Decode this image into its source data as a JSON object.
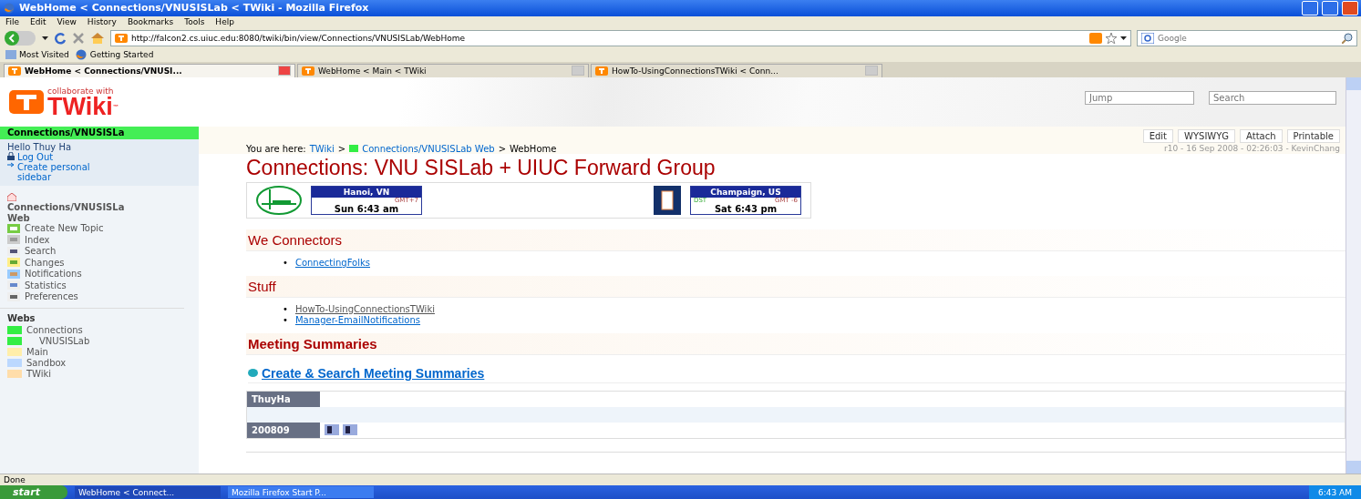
{
  "window": {
    "title": "WebHome < Connections/VNUSISLab < TWiki - Mozilla Firefox"
  },
  "menu": [
    "File",
    "Edit",
    "View",
    "History",
    "Bookmarks",
    "Tools",
    "Help"
  ],
  "nav": {
    "url": "http://falcon2.cs.uiuc.edu:8080/twiki/bin/view/Connections/VNUSISLab/WebHome",
    "search_placeholder": "Google"
  },
  "bookmarks": [
    "Most Visited",
    "Getting Started"
  ],
  "tabs": [
    {
      "label": "WebHome < Connections/VNUSI...",
      "selected": true
    },
    {
      "label": "WebHome < Main < TWiki",
      "selected": false
    },
    {
      "label": "HowTo-UsingConnectionsTWiki < Conn...",
      "selected": false
    }
  ],
  "header": {
    "tagline": "collaborate with",
    "logo": "TWiki",
    "tm": "™",
    "jump_placeholder": "Jump",
    "search_placeholder": "Search"
  },
  "sidebar": {
    "web_bar": "Connections/VNUSISLa",
    "greeting": "Hello Thuy Ha",
    "user_links": [
      {
        "kind": "lock",
        "label": "Log Out"
      },
      {
        "kind": "arrow",
        "label": "Create personal sidebar"
      }
    ],
    "web_name": "Connections/VNUSISLa",
    "web_suffix": "Web",
    "tools": [
      {
        "kind": "add",
        "label": "Create New Topic"
      },
      {
        "kind": "index",
        "label": "Index"
      },
      {
        "kind": "search",
        "label": "Search"
      },
      {
        "kind": "changes",
        "label": "Changes"
      },
      {
        "kind": "notify",
        "label": "Notifications"
      },
      {
        "kind": "stats",
        "label": "Statistics"
      },
      {
        "kind": "prefs",
        "label": "Preferences"
      }
    ],
    "webs_heading": "Webs",
    "webs": [
      {
        "label": "Connections",
        "color": "#33ee44",
        "children": [
          {
            "label": "VNUSISLab",
            "color": "#33ee44"
          }
        ]
      },
      {
        "label": "Main",
        "color": "#ffeeaa"
      },
      {
        "label": "Sandbox",
        "color": "#bbd8ff"
      },
      {
        "label": "TWiki",
        "color": "#ffddaa"
      }
    ]
  },
  "main": {
    "actions": [
      "Edit",
      "WYSIWYG",
      "Attach",
      "Printable"
    ],
    "breadcrumb": {
      "label": "You are here:",
      "items": [
        {
          "kind": "link",
          "text": "TWiki"
        },
        {
          "kind": "sep",
          "text": ">"
        },
        {
          "kind": "web",
          "text": "Connections/VNUSISLab Web"
        },
        {
          "kind": "sep",
          "text": ">"
        },
        {
          "kind": "current",
          "text": "WebHome"
        }
      ]
    },
    "revision": "r10 - 16 Sep 2008 - 02:26:03 - KevinChang",
    "title": "Connections: VNU SISLab + UIUC Forward Group",
    "clocks": [
      {
        "city": "Hanoi, VN",
        "zone": "GMT+7",
        "time": "Sun 6:43 am"
      },
      {
        "city": "Champaign, US",
        "dst": "DST",
        "zone": "GMT -6",
        "time": "Sat 6:43 pm"
      }
    ],
    "sections": [
      {
        "heading": "We Connectors",
        "links": [
          {
            "bullet": "•",
            "text": "ConnectingFolks",
            "visited": false
          }
        ]
      },
      {
        "heading": "Stuff",
        "links": [
          {
            "bullet": "•",
            "text": "HowTo-UsingConnectionsTWiki",
            "visited": true
          },
          {
            "bullet": "•",
            "text": "Manager-EmailNotifications",
            "visited": false
          }
        ]
      }
    ],
    "meeting_heading": "Meeting Summaries",
    "meeting_link": "Create & Search Meeting Summaries",
    "table": {
      "header": "ThuyHa",
      "row": "200809"
    }
  },
  "status_bar": "Done",
  "taskbar": {
    "start": "start",
    "items": [
      {
        "label": "WebHome < Connect...",
        "selected": true
      },
      {
        "label": "Mozilla Firefox Start P...",
        "selected": false
      }
    ],
    "clock": "6:43 AM"
  }
}
